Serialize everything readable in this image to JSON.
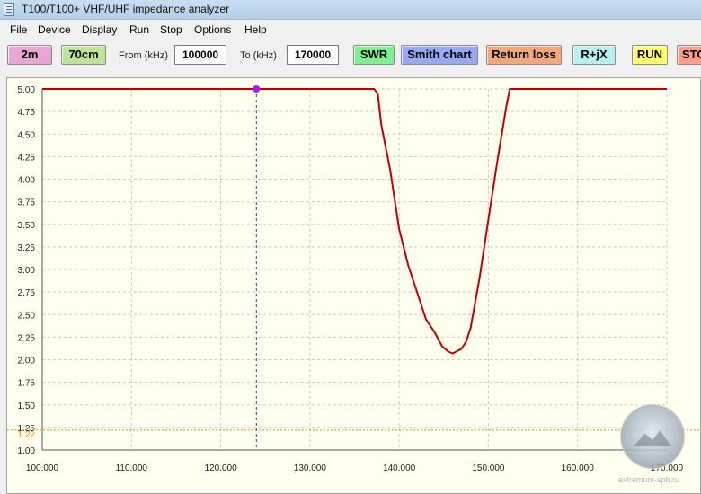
{
  "window": {
    "title": "T100/T100+ VHF/UHF impedance analyzer"
  },
  "menu": [
    "File",
    "Device",
    "Display",
    "Run",
    "Stop",
    "Options",
    "Help"
  ],
  "toolbar": {
    "band_2m": "2m",
    "band_70cm": "70cm",
    "from_label": "From (kHz)",
    "from_value": "100000",
    "to_label": "To (kHz)",
    "to_value": "170000",
    "swr": "SWR",
    "smith": "Smith chart",
    "return_loss": "Return loss",
    "rjx": "R+jX",
    "run": "RUN",
    "stop": "STO"
  },
  "colors": {
    "btn_2m": "#e8a7d3",
    "btn_70cm": "#bde39b",
    "btn_swr": "#7ff08f",
    "btn_smith": "#98a8f5",
    "btn_return_loss": "#f5a77c",
    "btn_rjx": "#b7f0ee",
    "btn_run": "#ffff66",
    "btn_stop": "#ff9c8c",
    "curve": "#c00000",
    "marker": "#a020f0",
    "threshold": "#e08a2e"
  },
  "watermark": {
    "text": "extremum-spb.ru"
  },
  "chart_data": {
    "type": "line",
    "xlim": [
      100,
      170
    ],
    "ylim": [
      1.0,
      5.0
    ],
    "x_ticks": [
      "100.000",
      "110.000",
      "120.000",
      "130.000",
      "140.000",
      "150.000",
      "160.000",
      "170.000"
    ],
    "y_ticks": [
      "5.00",
      "4.75",
      "4.50",
      "4.25",
      "4.00",
      "3.75",
      "3.50",
      "3.25",
      "3.00",
      "2.75",
      "2.50",
      "2.25",
      "2.00",
      "1.75",
      "1.50",
      "1.25",
      "1.00"
    ],
    "threshold": {
      "value": 1.22,
      "label": "1.22"
    },
    "marker_x": 124,
    "grid": true,
    "series": [
      {
        "x": [
          100,
          137.2,
          137.6,
          138.0,
          139.0,
          140.0,
          141.0,
          142.0,
          143.0,
          144.0,
          144.8,
          145.5,
          146.0,
          147.0,
          147.5,
          148.0,
          149.0,
          150.0,
          151.0,
          152.0,
          152.4,
          170
        ],
        "y": [
          5.0,
          5.0,
          4.95,
          4.6,
          4.1,
          3.45,
          3.05,
          2.75,
          2.45,
          2.3,
          2.15,
          2.09,
          2.07,
          2.12,
          2.2,
          2.35,
          2.9,
          3.55,
          4.2,
          4.8,
          5.0,
          5.0
        ]
      }
    ]
  }
}
